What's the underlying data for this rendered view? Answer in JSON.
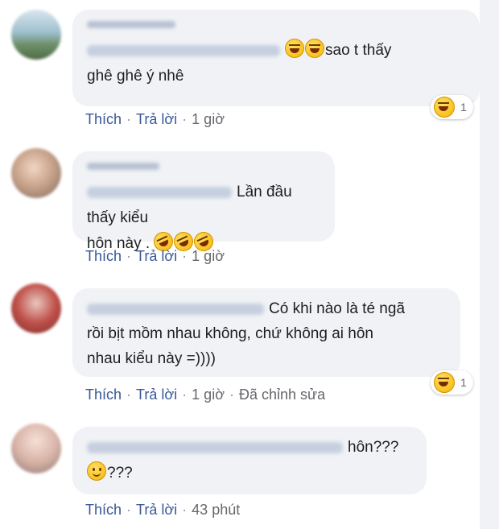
{
  "comments": [
    {
      "text_line1": "sao t thấy",
      "text_line2": "ghê ghê ý nhê",
      "reaction_count": "1",
      "actions": {
        "like": "Thích",
        "reply": "Trả lời",
        "time": "1 giờ"
      }
    },
    {
      "text_line1": "Lần đầu thấy kiểu",
      "text_line2": "hôn này .",
      "actions": {
        "like": "Thích",
        "reply": "Trả lời",
        "time": "1 giờ"
      }
    },
    {
      "text_line1": "Có khi nào là té ngã",
      "text_line2": "rồi bịt mồm nhau không, chứ không ai hôn",
      "text_line3": "nhau kiểu này =))))",
      "reaction_count": "1",
      "actions": {
        "like": "Thích",
        "reply": "Trả lời",
        "time": "1 giờ",
        "edited": "Đã chỉnh sửa"
      }
    },
    {
      "text_line1": "hôn???",
      "text_line2": "???",
      "actions": {
        "like": "Thích",
        "reply": "Trả lời",
        "time": "43 phút"
      }
    }
  ],
  "icons": {
    "laugh": "face-with-tears-of-joy-icon",
    "rofl": "rolling-on-floor-laughing-icon",
    "smile": "slightly-smiling-face-icon"
  },
  "colors": {
    "bubble": "#f0f2f5",
    "link": "#385898",
    "meta": "#65676b"
  }
}
